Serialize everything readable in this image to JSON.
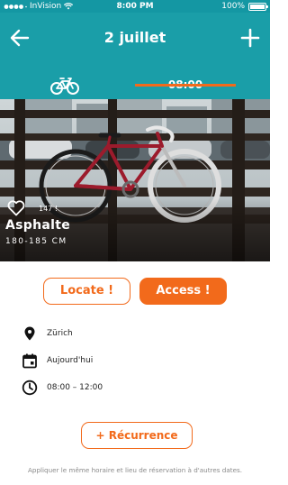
{
  "status_bar": {
    "carrier": "InVision",
    "time": "8:00 PM",
    "battery": "100%"
  },
  "header": {
    "title": "2 juillet",
    "back_icon": "arrow-left-icon",
    "add_icon": "plus-icon"
  },
  "tabs": [
    {
      "icon": "bicycle-icon",
      "active": false
    },
    {
      "label": "08:00",
      "active": true
    }
  ],
  "bike": {
    "likes": "147 !",
    "name": "Asphalte",
    "size": "180-185 CM"
  },
  "actions": {
    "locate_label": "Locate !",
    "access_label": "Access !"
  },
  "details": {
    "location": "Zürich",
    "date": "Aujourd'hui",
    "time_range": "08:00 – 12:00"
  },
  "recurrence": {
    "label": "+ Récurrence",
    "note": "Appliquer le même horaire et lieu de réservation à d'autres dates."
  },
  "colors": {
    "teal": "#1a9ea8",
    "accent": "#f26a1b"
  }
}
